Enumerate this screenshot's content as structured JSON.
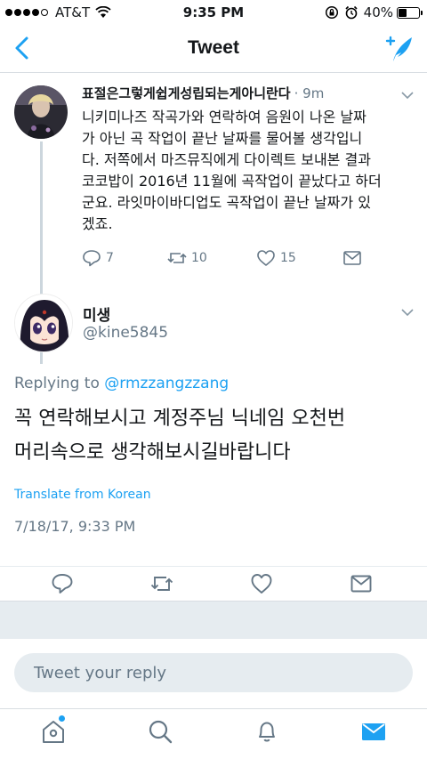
{
  "status_bar": {
    "carrier": "AT&T",
    "time": "9:35 PM",
    "battery": "40%",
    "battery_level": 0.4
  },
  "nav": {
    "title": "Tweet"
  },
  "parent_tweet": {
    "name": "표절은그렇게쉽게성립되는게아니란다",
    "time": "· 9m",
    "text": "니키미나즈 작곡가와 연락하여 음원이 나온 날짜\n가 아닌 곡 작업이 끝난 날짜를 물어볼 생각입니\n다. 저쪽에서 마즈뮤직에게 다이렉트 보내본 결과\n코코밥이 2016년 11월에 곡작업이 끝났다고 하더\n군요. 라잇마이바디업도 곡작업이 끝난 날짜가 있\n겠죠.",
    "replies": "7",
    "retweets": "10",
    "likes": "15"
  },
  "focused_tweet": {
    "name": "미생",
    "handle": "@kine5845",
    "replying_prefix": "Replying to ",
    "replying_handle": "@rmzzangzzang",
    "text": "꼭 연락해보시고 계정주님 닉네임 오천번\n머리속으로 생각해보시길바랍니다",
    "translate": "Translate from Korean",
    "timestamp": "7/18/17, 9:33 PM"
  },
  "reply_bar": {
    "placeholder": "Tweet your reply"
  },
  "colors": {
    "accent": "#1da1f2",
    "muted": "#657786",
    "background_gray": "#e6ecf0"
  }
}
